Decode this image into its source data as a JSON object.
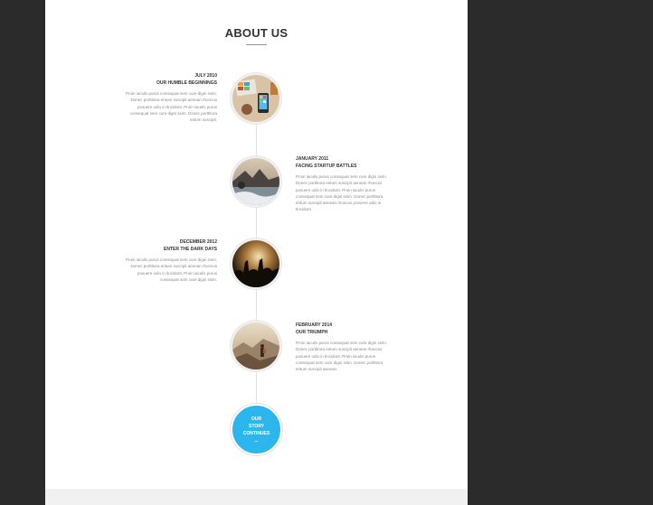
{
  "section": {
    "title": "ABOUT US"
  },
  "accent": "#29b6f6",
  "timeline": [
    {
      "date": "JULY 2010",
      "title": "OUR HUMBLE BEGINNINGS",
      "body": "Proin iaculis purus consequat sem cure digni ssim. Donec porttitora entum suscipit aenean rhoncus posuere odio in tincidunt. Proin iaculis purus consequat sem cure digni ssim. Donec porttitora entum suscipit.",
      "image_icon": "workspace-photo"
    },
    {
      "date": "JANUARY 2011",
      "title": "FACING STARTUP BATTLES",
      "body": "Proin iaculis purus consequat sem cure digni ssim. Donec porttitora entum suscipit aenean rhoncus posuere odio in tincidunt. Proin iaculis purus consequat sem cure digni ssim. Donec porttitora entum suscipit aenean rhoncus posuere odio in tincidunt.",
      "image_icon": "sea-rocks-photo"
    },
    {
      "date": "DECEMBER 2012",
      "title": "ENTER THE DARK DAYS",
      "body": "Proin iaculis purus consequat sem cure digni ssim. Donec porttitora entum suscipit aenean rhoncus posuere odio in tincidunt. Proin iaculis purus consequat sem cure digni ssim.",
      "image_icon": "concert-crowd-photo"
    },
    {
      "date": "FEBRUARY 2014",
      "title": "OUR TRIUMPH",
      "body": "Proin iaculis purus consequat sem cure digni ssim. Donec porttitora entum suscipit aenean rhoncus posuere odio in tincidunt. Proin iaculis purus consequat sem cure digni ssim. Donec porttitora entum suscipit aenean.",
      "image_icon": "hiker-mountain-photo"
    }
  ],
  "final": {
    "line1": "OUR",
    "line2": "STORY",
    "line3": "CONTINUES",
    "line4": "..."
  }
}
